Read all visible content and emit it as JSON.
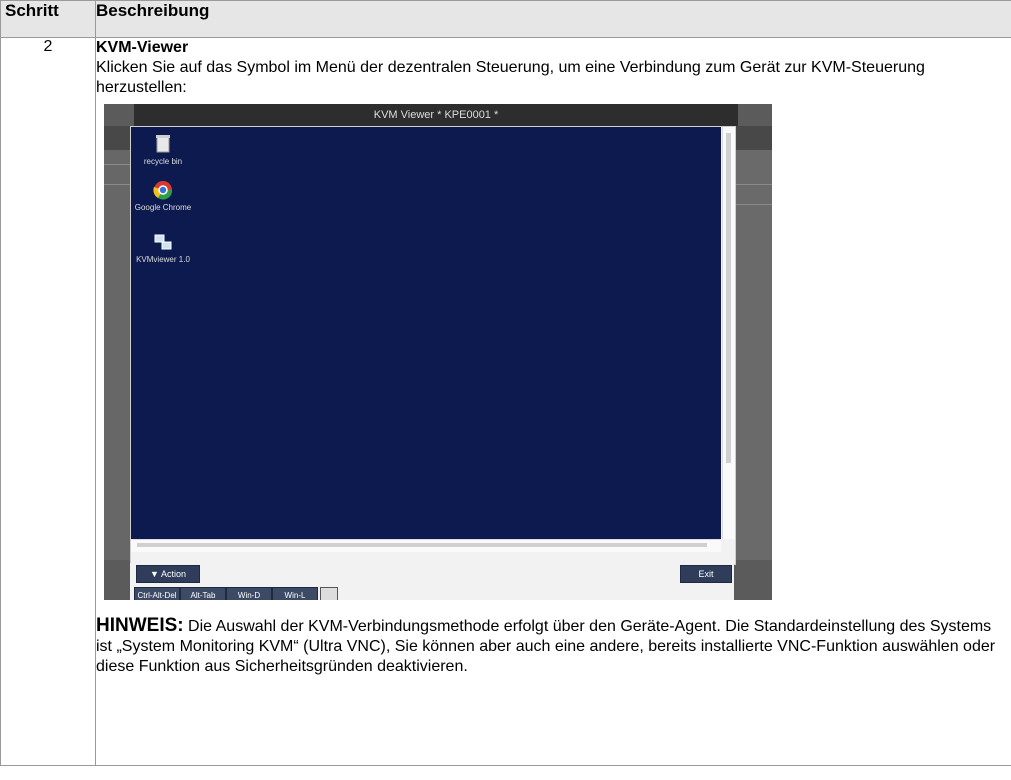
{
  "table": {
    "header": {
      "col_step": "Schritt",
      "col_desc": "Beschreibung"
    },
    "row": {
      "step_number": "2",
      "title": "KVM-Viewer",
      "intro": "Klicken Sie auf das Symbol im Menü der dezentralen Steuerung, um eine Verbindung zum Gerät zur KVM-Steuerung herzustellen:",
      "note_label": "HINWEIS:",
      "note_text": " Die Auswahl der KVM-Verbindungsmethode erfolgt über den Geräte-Agent. Die Standardeinstellung des Systems ist „System Monitoring KVM“ (Ultra VNC), Sie können aber auch eine andere, bereits installierte VNC-Funktion auswählen oder diese Funktion aus Sicherheitsgründen deaktivieren."
    }
  },
  "screenshot": {
    "window_title": "KVM Viewer * KPE0001 *",
    "desktop_bg": "#0c1a4f",
    "desktop_icons": [
      {
        "icon": "recycle-bin-icon",
        "label": "recycle bin"
      },
      {
        "icon": "chrome-icon",
        "label": "Google Chrome"
      },
      {
        "icon": "network-icon",
        "label": "KVMviewer 1.0"
      }
    ],
    "action_button": "▼  Action",
    "exit_button": "Exit",
    "key_buttons": [
      "Ctrl-Alt-Del",
      "Alt-Tab",
      "Win-D",
      "Win-L"
    ]
  }
}
